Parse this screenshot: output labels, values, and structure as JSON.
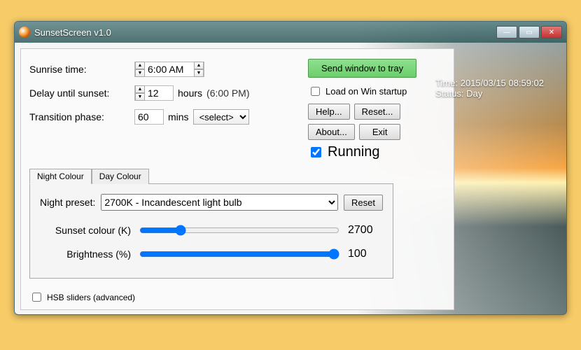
{
  "window": {
    "title": "SunsetScreen v1.0"
  },
  "labels": {
    "sunrise": "Sunrise time:",
    "delay": "Delay until sunset:",
    "transition": "Transition phase:",
    "hours": "hours",
    "mins": "mins",
    "sunset_pm": "(6:00 PM)",
    "load_startup": "Load on Win startup",
    "running": "Running",
    "hsb": "HSB sliders (advanced)",
    "night_preset": "Night preset:",
    "sunset_colour": "Sunset colour (K)",
    "brightness": "Brightness (%)",
    "time_prefix": "Time: ",
    "status_prefix": "Status: "
  },
  "values": {
    "sunrise_time": "6:00 AM",
    "delay_hours": "12",
    "transition_mins": "60",
    "select_placeholder": "<select>",
    "preset_selected": "2700K - Incandescent light bulb",
    "sunset_colour_k": "2700",
    "brightness_pct": "100",
    "time": "2015/03/15 08:59:02",
    "status": "Day"
  },
  "buttons": {
    "tray": "Send window to tray",
    "help": "Help...",
    "reset": "Reset...",
    "about": "About...",
    "exit": "Exit",
    "preset_reset": "Reset"
  },
  "tabs": {
    "night": "Night Colour",
    "day": "Day Colour"
  }
}
